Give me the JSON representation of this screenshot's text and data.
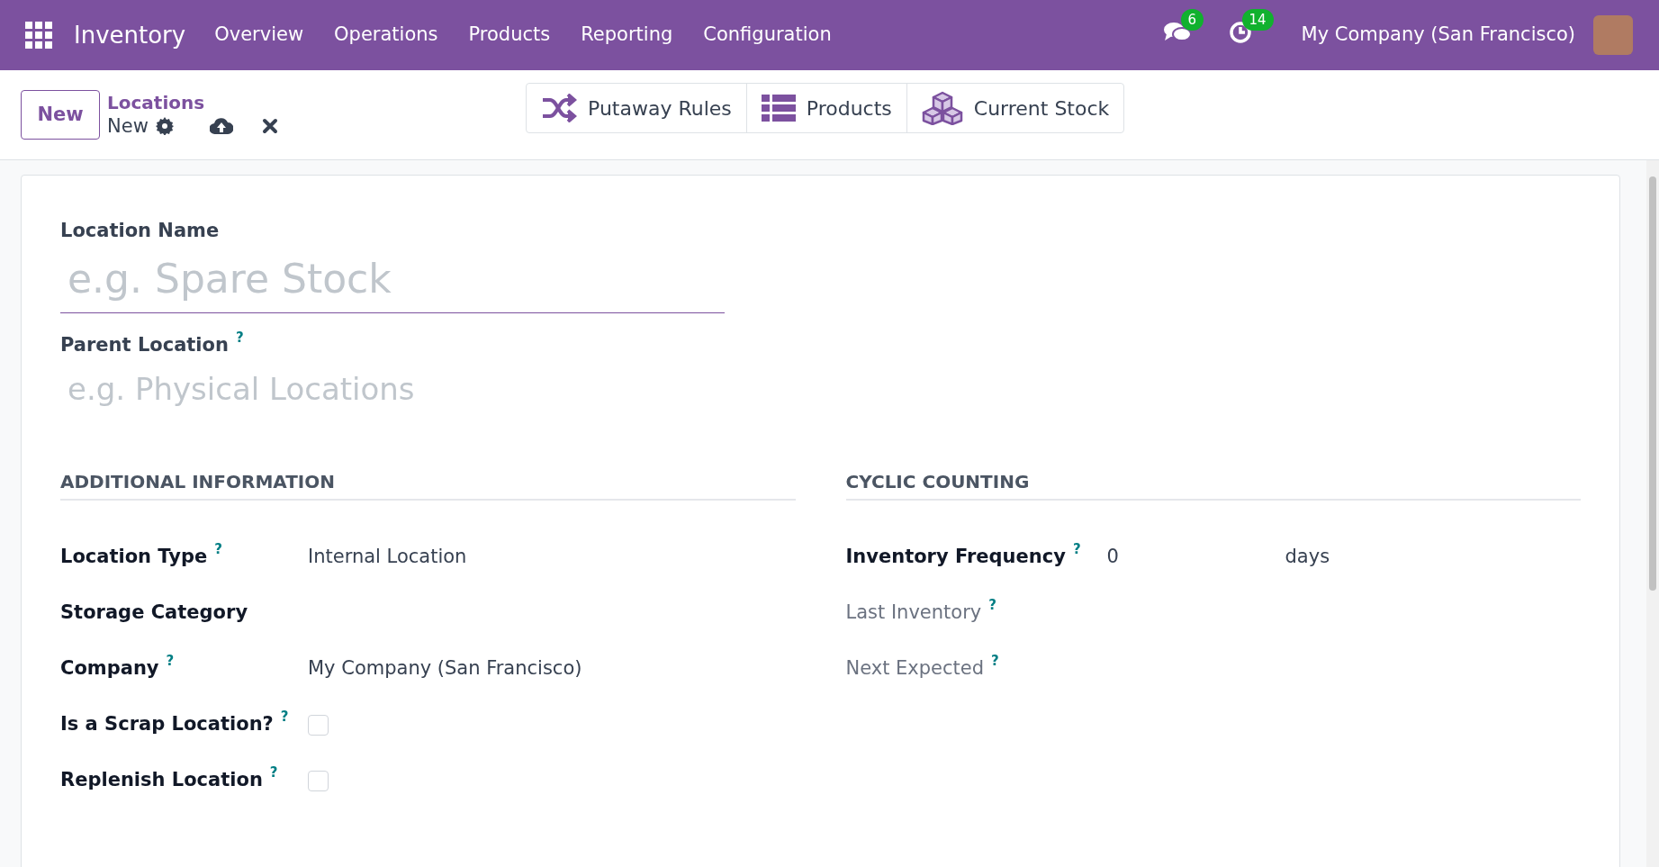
{
  "navbar": {
    "app_name": "Inventory",
    "menu": [
      "Overview",
      "Operations",
      "Products",
      "Reporting",
      "Configuration"
    ],
    "messages_badge": "6",
    "activities_badge": "14",
    "company": "My Company (San Francisco)"
  },
  "control_panel": {
    "new_button": "New",
    "breadcrumb": "Locations",
    "record_title": "New"
  },
  "smart_buttons": [
    {
      "kind": "shuffle",
      "label": "Putaway Rules"
    },
    {
      "kind": "list",
      "label": "Products"
    },
    {
      "kind": "cubes",
      "label": "Current Stock"
    }
  ],
  "form": {
    "name_label": "Location Name",
    "name_placeholder": "e.g. Spare Stock",
    "parent_label": "Parent Location",
    "parent_help": "?",
    "parent_placeholder": "e.g. Physical Locations",
    "groups": [
      {
        "title": "ADDITIONAL INFORMATION",
        "fields": [
          {
            "kind": "text",
            "label": "Location Type",
            "help": "?",
            "readonly": false,
            "value": "Internal Location"
          },
          {
            "kind": "text",
            "label": "Storage Category",
            "readonly": false
          },
          {
            "kind": "text",
            "label": "Company",
            "help": "?",
            "readonly": false,
            "value": "My Company (San Francisco)"
          },
          {
            "kind": "checkbox",
            "label": "Is a Scrap Location?",
            "help": "?",
            "readonly": false,
            "checked": false
          },
          {
            "kind": "checkbox",
            "label": "Replenish Location",
            "help": "?",
            "readonly": false,
            "checked": false
          }
        ]
      },
      {
        "title": "CYCLIC COUNTING",
        "fields": [
          {
            "kind": "number",
            "label": "Inventory Frequency",
            "help": "?",
            "readonly": false,
            "value": "0",
            "unit": "days"
          },
          {
            "kind": "text",
            "label": "Last Inventory",
            "help": "?",
            "readonly": true
          },
          {
            "kind": "text",
            "label": "Next Expected",
            "help": "?",
            "readonly": true
          }
        ]
      }
    ]
  }
}
